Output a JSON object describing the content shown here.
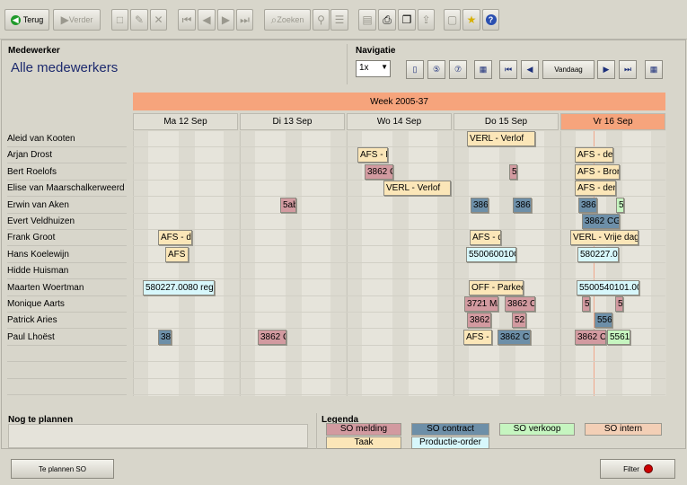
{
  "toolbar": {
    "back_label": "Terug",
    "forward_label": "Verder",
    "search_label": "Zoeken"
  },
  "employee_section": {
    "label": "Medewerker",
    "title": "Alle medewerkers"
  },
  "navigation": {
    "label": "Navigatie",
    "zoom_value": "1x",
    "today_label": "Vandaag"
  },
  "week_label": "Week 2005-37",
  "days": [
    "Ma 12 Sep",
    "Di 13 Sep",
    "Wo 14 Sep",
    "Do 15 Sep",
    "Vr 16 Sep"
  ],
  "employees": [
    "Aleid van Kooten",
    "Arjan Drost",
    "Bert Roelofs",
    "Elise van Maarschalkerweerd",
    "Erwin van Aken",
    "Evert Veldhuizen",
    "Frank Groot",
    "Hans Koelewijn",
    "Hidde Huisman",
    "Maarten Woertman",
    "Monique Aarts",
    "Patrick Aries",
    "Paul Lhoëst"
  ],
  "appointments": [
    {
      "text": "VERL - Verlof",
      "type": "taak"
    },
    {
      "text": "AFS - D",
      "type": "taak"
    },
    {
      "text": "AFS - der",
      "type": "taak"
    },
    {
      "text": "3862 C",
      "type": "melding"
    },
    {
      "text": "5",
      "type": "melding"
    },
    {
      "text": "AFS - Bron",
      "type": "taak"
    },
    {
      "text": "VERL - Verlof",
      "type": "taak"
    },
    {
      "text": "AFS - der",
      "type": "taak"
    },
    {
      "text": "5ab",
      "type": "melding"
    },
    {
      "text": "386",
      "type": "contract"
    },
    {
      "text": "3862",
      "type": "contract"
    },
    {
      "text": "3862",
      "type": "contract"
    },
    {
      "text": "5",
      "type": "verkoop"
    },
    {
      "text": "3862 CG",
      "type": "contract"
    },
    {
      "text": "AFS - de",
      "type": "taak"
    },
    {
      "text": "AFS - d",
      "type": "taak"
    },
    {
      "text": "VERL - Vrije dag",
      "type": "taak"
    },
    {
      "text": "AFS",
      "type": "taak"
    },
    {
      "text": "550060010C",
      "type": "prod"
    },
    {
      "text": "580227.00",
      "type": "prod"
    },
    {
      "text": "580227.0080 rege",
      "type": "prod"
    },
    {
      "text": "OFF - Parkee",
      "type": "taak"
    },
    {
      "text": "5500540101.00",
      "type": "prod"
    },
    {
      "text": "3721 M/",
      "type": "melding"
    },
    {
      "text": "3862 C",
      "type": "melding"
    },
    {
      "text": "5",
      "type": "melding"
    },
    {
      "text": "5",
      "type": "melding"
    },
    {
      "text": "3862",
      "type": "melding"
    },
    {
      "text": "52",
      "type": "melding"
    },
    {
      "text": "556",
      "type": "contract"
    },
    {
      "text": "38",
      "type": "contract"
    },
    {
      "text": "3862 C",
      "type": "melding"
    },
    {
      "text": "AFS -",
      "type": "taak"
    },
    {
      "text": "3862 CC",
      "type": "contract"
    },
    {
      "text": "3862 C",
      "type": "melding"
    },
    {
      "text": "5561",
      "type": "verkoop"
    }
  ],
  "unplanned": {
    "label": "Nog te plannen"
  },
  "legend": {
    "label": "Legenda",
    "items": [
      {
        "label": "SO melding",
        "type": "melding",
        "color": "#d29aa0"
      },
      {
        "label": "SO contract",
        "type": "contract",
        "color": "#6d8fa8"
      },
      {
        "label": "SO verkoop",
        "type": "verkoop",
        "color": "#c6f5c0"
      },
      {
        "label": "SO intern",
        "type": "intern",
        "color": "#f3cfb6"
      },
      {
        "label": "Taak",
        "type": "taak",
        "color": "#fbe6b8"
      },
      {
        "label": "Productie-order",
        "type": "prod",
        "color": "#d7f7fb"
      }
    ]
  },
  "bottom": {
    "plan_button": "Te plannen SO",
    "filter_button": "Filter"
  }
}
